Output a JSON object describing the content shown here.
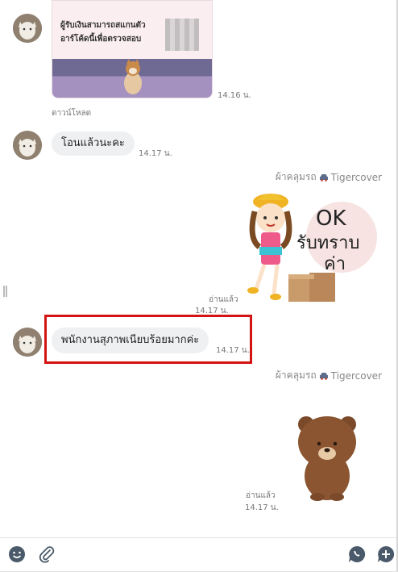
{
  "messages": {
    "image_card": {
      "caption_line1": "ผู้รับเงินสามารถสแกนตัว",
      "caption_line2": "อาร์โค้ดนี้เพื่อตรวจสอบ",
      "time": "14.16 น.",
      "download_label": "ดาวน์โหลด"
    },
    "msg1": {
      "text": "โอนแล้วนะคะ",
      "time": "14.17 น."
    },
    "sticker1": {
      "sender": "ผ้าคลุมรถ",
      "sender_brand": "Tigercover",
      "text_ok": "OK",
      "text_line2": "รับทราบ",
      "text_line3": "ค่า",
      "read": "อ่านแล้ว",
      "time": "14.17 น."
    },
    "msg2": {
      "text": "พนักงานสุภาพเนียบร้อยมากค่ะ",
      "time": "14.17 น."
    },
    "sticker2": {
      "sender": "ผ้าคลุมรถ",
      "sender_brand": "Tigercover",
      "read": "อ่านแล้ว",
      "time": "14.17 น."
    }
  },
  "colors": {
    "highlight": "#d41313",
    "bubble": "#eef0f2",
    "icon": "#4a5a6a"
  },
  "icons": {
    "emoji": "smiley-icon",
    "attach": "paperclip-icon",
    "call": "phone-bubble-icon",
    "new_chat": "add-chat-icon"
  }
}
